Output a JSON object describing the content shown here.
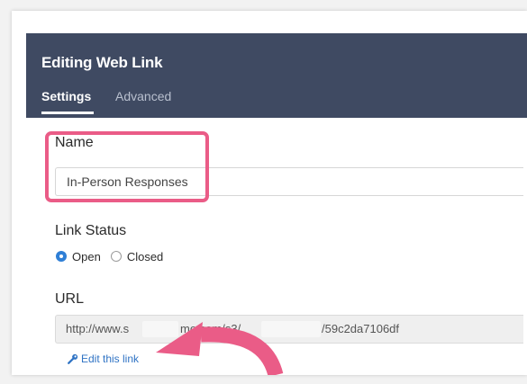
{
  "dialog": {
    "title": "Editing Web Link",
    "tabs": [
      {
        "label": "Settings",
        "active": true
      },
      {
        "label": "Advanced",
        "active": false
      }
    ]
  },
  "name_section": {
    "label": "Name",
    "value": "In-Person Responses"
  },
  "link_status": {
    "label": "Link Status",
    "options": [
      {
        "label": "Open",
        "selected": true
      },
      {
        "label": "Closed",
        "selected": false
      }
    ]
  },
  "url_section": {
    "label": "URL",
    "url_start": "http://www.s",
    "url_middle": "mo.com/s3/",
    "url_end": "/59c2da7106df",
    "edit_link_label": "Edit this link"
  },
  "colors": {
    "header": "#3f4a62",
    "highlight": "#ea5c87",
    "link": "#2f73c4",
    "radio_selected": "#2f7fd6"
  },
  "icons": [
    "wrench-icon",
    "curved-arrow-icon"
  ]
}
